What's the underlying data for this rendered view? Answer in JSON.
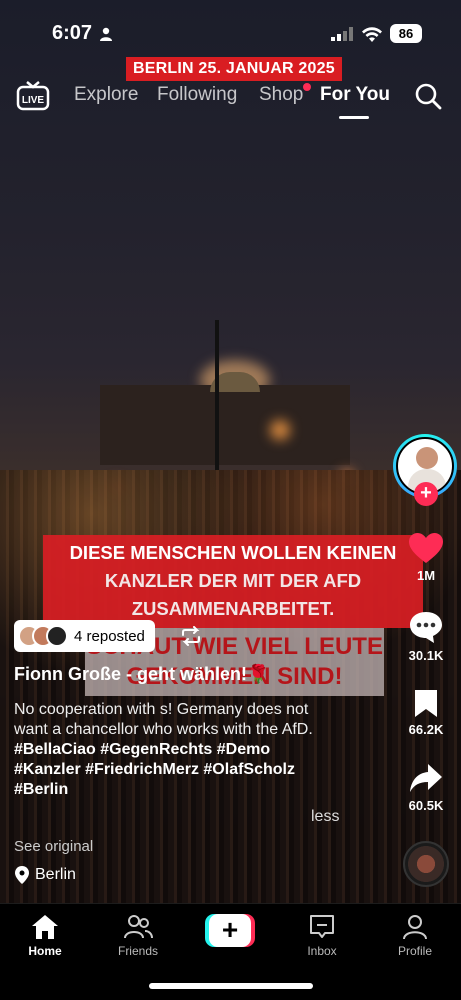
{
  "status_bar": {
    "time": "6:07",
    "battery": "86"
  },
  "overlay_banner": "BERLIN 25. JANUAR 2025",
  "nav": {
    "live_label": "LIVE",
    "tabs": [
      "Explore",
      "Following",
      "Shop",
      "For You"
    ],
    "active_tab": "For You"
  },
  "video_captions": {
    "red_lines": [
      "DIESE MENSCHEN WOLLEN KEINEN",
      "KANZLER DER MIT DER AFD",
      "ZUSAMMENARBEITET."
    ],
    "gray_lines": [
      "SCHAUT WIE VIEL LEUTE",
      "GEKOMMEN SIND!"
    ]
  },
  "actions": {
    "likes": "1M",
    "comments": "30.1K",
    "saves": "66.2K",
    "shares": "60.5K"
  },
  "repost": {
    "label": "4 reposted"
  },
  "post": {
    "author": "Fionn Große - geht wählen!🌹",
    "description": "No cooperation with s! Germany does not want a chancellor who works with the AfD.",
    "hashtags": "#BellaCiao #GegenRechts #Demo #Kanzler #FriedrichMerz #OlafScholz #Berlin",
    "less_label": "less",
    "see_original": "See original",
    "location": "Berlin"
  },
  "bottom_tabs": {
    "home": "Home",
    "friends": "Friends",
    "inbox": "Inbox",
    "profile": "Profile"
  },
  "colors": {
    "accent": "#fe2c55",
    "cyan": "#25f4ee",
    "banner_red": "#d91d22"
  }
}
